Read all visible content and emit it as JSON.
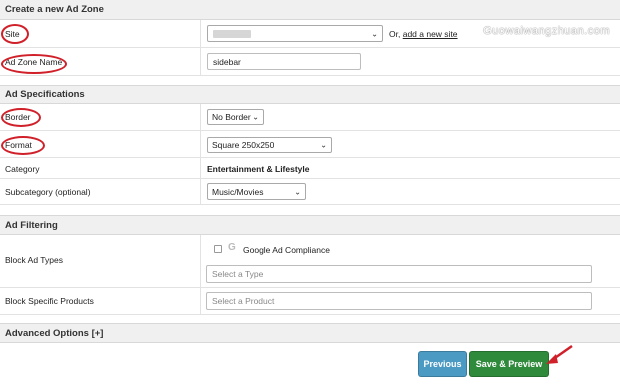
{
  "sections": {
    "create": "Create a new Ad Zone",
    "specs": "Ad Specifications",
    "filtering": "Ad Filtering",
    "advanced": "Advanced Options [+]"
  },
  "fields": {
    "site": {
      "label": "Site",
      "or_text": "Or,",
      "add_link": "add a new site"
    },
    "zone_name": {
      "label": "Ad Zone Name",
      "value": "sidebar"
    },
    "border": {
      "label": "Border",
      "value": "No Border"
    },
    "format": {
      "label": "Format",
      "value": "Square 250x250"
    },
    "category": {
      "label": "Category",
      "value": "Entertainment & Lifestyle"
    },
    "subcategory": {
      "label": "Subcategory (optional)",
      "value": "Music/Movies"
    },
    "block_types": {
      "label": "Block Ad Types",
      "compliance": "Google Ad Compliance",
      "placeholder": "Select a Type"
    },
    "block_products": {
      "label": "Block Specific Products",
      "placeholder": "Select a Product"
    }
  },
  "buttons": {
    "previous": "Previous",
    "save": "Save & Preview"
  },
  "watermark": "Guowaiwangzhuan.com",
  "colors": {
    "annotation": "#d0202a",
    "previous": "#4a9ac4",
    "save": "#2f8a3c"
  },
  "icons": {
    "google": "G",
    "chevron": "⌄"
  }
}
